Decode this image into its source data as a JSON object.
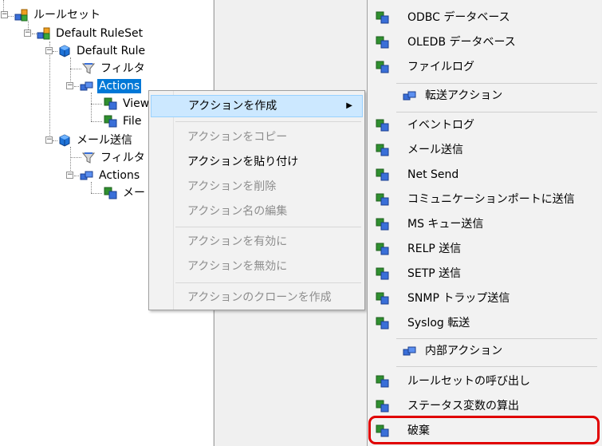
{
  "tree": {
    "ruleset_root": "ルールセット",
    "default_ruleset": "Default RuleSet",
    "default_rule": "Default Rule",
    "filter_1": "フィルタ",
    "actions_1": "Actions",
    "view_partial": "View",
    "file_partial": "File",
    "mail_rule": "メール送信",
    "filter_2": "フィルタ",
    "actions_2": "Actions",
    "mail_partial": "メー"
  },
  "context_menu": {
    "create_action": "アクションを作成",
    "copy_action": "アクションをコピー",
    "paste_action": "アクションを貼り付け",
    "delete_action": "アクションを削除",
    "rename_action": "アクション名の編集",
    "enable_action": "アクションを有効に",
    "disable_action": "アクションを無効に",
    "clone_action": "アクションのクローンを作成"
  },
  "submenu": {
    "odbc": "ODBC データベース",
    "oledb": "OLEDB データベース",
    "filelog": "ファイルログ",
    "forward_header": "転送アクション",
    "eventlog": "イベントログ",
    "send_mail": "メール送信",
    "net_send": "Net Send",
    "comm_port": "コミュニケーションポートに送信",
    "ms_queue": "MS キュー送信",
    "relp": "RELP 送信",
    "setp": "SETP 送信",
    "snmp_trap": "SNMP トラップ送信",
    "syslog": "Syslog 転送",
    "internal_header": "内部アクション",
    "call_ruleset": "ルールセットの呼び出し",
    "status_var": "ステータス変数の算出",
    "discard": "破棄"
  },
  "colors": {
    "selection": "#0078d7",
    "menu_highlight": "#cce8ff",
    "callout": "#e00000"
  }
}
